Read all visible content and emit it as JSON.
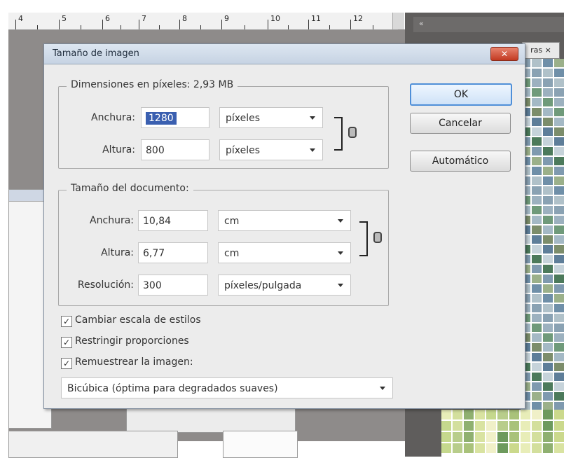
{
  "ruler": {
    "numbers": [
      "4",
      "5",
      "6",
      "7",
      "8",
      "9",
      "10",
      "11",
      "12"
    ]
  },
  "right_panel": {
    "tab_label": "ras ×",
    "tab_back": "«"
  },
  "colors": {
    "tiles_top": [
      "#8aa2b3",
      "#5e7e99",
      "#6f8fa8",
      "#a4b9c5",
      "#7f9aaf",
      "#9cb1bf",
      "#c6d3da",
      "#b0c1c9",
      "#7c8d6b",
      "#9bb08a",
      "#6f9a7a",
      "#4c7a5b"
    ],
    "tiles_bottom": [
      "#e8edb8",
      "#d9e3a1",
      "#cbd98c",
      "#a9c27a",
      "#8fb070",
      "#6d9a5d",
      "#b8cd8b",
      "#d3df9d",
      "#f0f0c8",
      "#c5d88d"
    ]
  },
  "dialog": {
    "title": "Tamaño de imagen",
    "pixel_group": {
      "legend": "Dimensiones en píxeles: 2,93 MB",
      "width_label": "Anchura:",
      "width_value": "1280",
      "width_unit": "píxeles",
      "height_label": "Altura:",
      "height_value": "800",
      "height_unit": "píxeles"
    },
    "doc_group": {
      "legend": "Tamaño del documento:",
      "width_label": "Anchura:",
      "width_value": "10,84",
      "width_unit": "cm",
      "height_label": "Altura:",
      "height_value": "6,77",
      "height_unit": "cm",
      "res_label": "Resolución:",
      "res_value": "300",
      "res_unit": "píxeles/pulgada"
    },
    "buttons": {
      "ok": "OK",
      "cancel": "Cancelar",
      "auto": "Automático"
    },
    "checks": [
      {
        "label": "Cambiar escala de estilos",
        "checked": true
      },
      {
        "label": "Restringir proporciones",
        "checked": true
      },
      {
        "label": "Remuestrear la imagen:",
        "checked": true
      }
    ],
    "resample": "Bicúbica (óptima para degradados suaves)"
  }
}
